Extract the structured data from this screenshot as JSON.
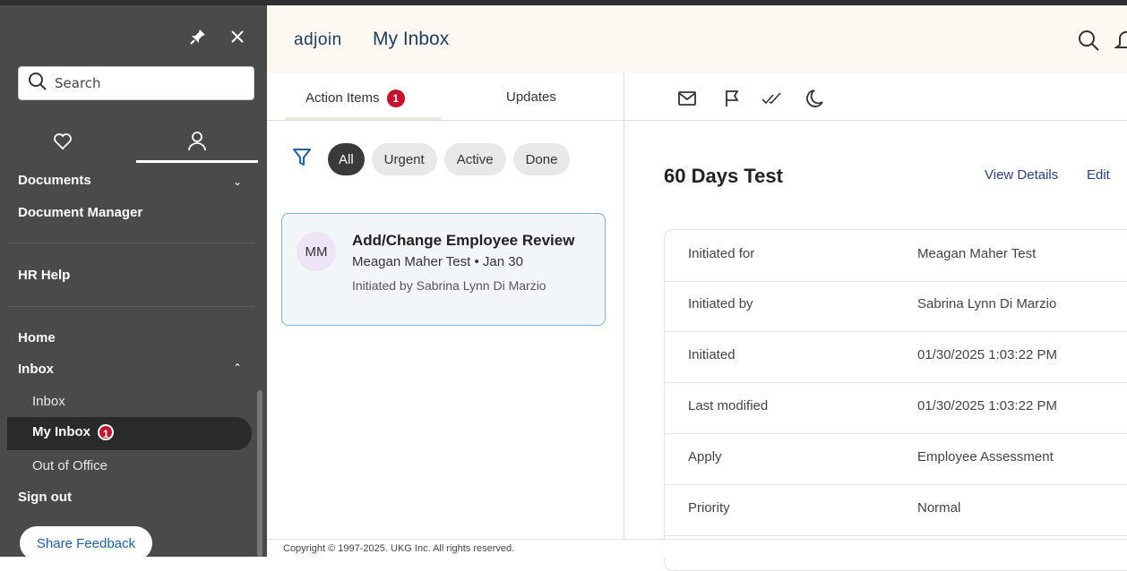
{
  "sidebar": {
    "search_placeholder": "Search",
    "items": {
      "documents": "Documents",
      "document_manager": "Document Manager",
      "hr_help": "HR Help",
      "home": "Home",
      "inbox": "Inbox",
      "inbox_sub": "Inbox",
      "my_inbox": "My Inbox",
      "my_inbox_badge": "1",
      "out_of_office": "Out of Office",
      "sign_out": "Sign out"
    },
    "feedback_label": "Share Feedback"
  },
  "header": {
    "logo": "adjoin",
    "title": "My Inbox"
  },
  "tabs": {
    "action_items": "Action Items",
    "action_items_badge": "1",
    "updates": "Updates"
  },
  "filters": [
    "All",
    "Urgent",
    "Active",
    "Done"
  ],
  "card": {
    "initials": "MM",
    "title": "Add/Change Employee Review",
    "subtitle": "Meagan Maher Test • Jan 30",
    "initiated": "Initiated by Sabrina Lynn Di Marzio"
  },
  "detail": {
    "title": "60 Days Test",
    "view_details": "View Details",
    "edit": "Edit",
    "rows": [
      {
        "label": "Initiated for",
        "value": "Meagan Maher Test"
      },
      {
        "label": "Initiated by",
        "value": "Sabrina Lynn Di Marzio"
      },
      {
        "label": "Initiated",
        "value": "01/30/2025 1:03:22 PM"
      },
      {
        "label": "Last modified",
        "value": "01/30/2025 1:03:22 PM"
      },
      {
        "label": "Apply",
        "value": "Employee Assessment"
      },
      {
        "label": "Priority",
        "value": "Normal"
      }
    ]
  },
  "footer": {
    "copyright": "Copyright © 1997-2025. UKG Inc. All rights reserved."
  },
  "icons": {
    "pin": "pin-icon",
    "close": "close-icon",
    "search": "search-icon",
    "heart": "heart-icon",
    "user": "user-icon",
    "filter": "filter-icon",
    "mail": "mail-icon",
    "flag": "flag-icon",
    "check": "double-check-icon",
    "moon": "moon-icon",
    "bell": "bell-icon"
  },
  "colors": {
    "sidebar_bg": "#4a4a4a",
    "badge": "#c8102e",
    "header_bg": "#fdf8f2",
    "link": "#2a3d8f",
    "card_border": "#7fb0d6"
  }
}
